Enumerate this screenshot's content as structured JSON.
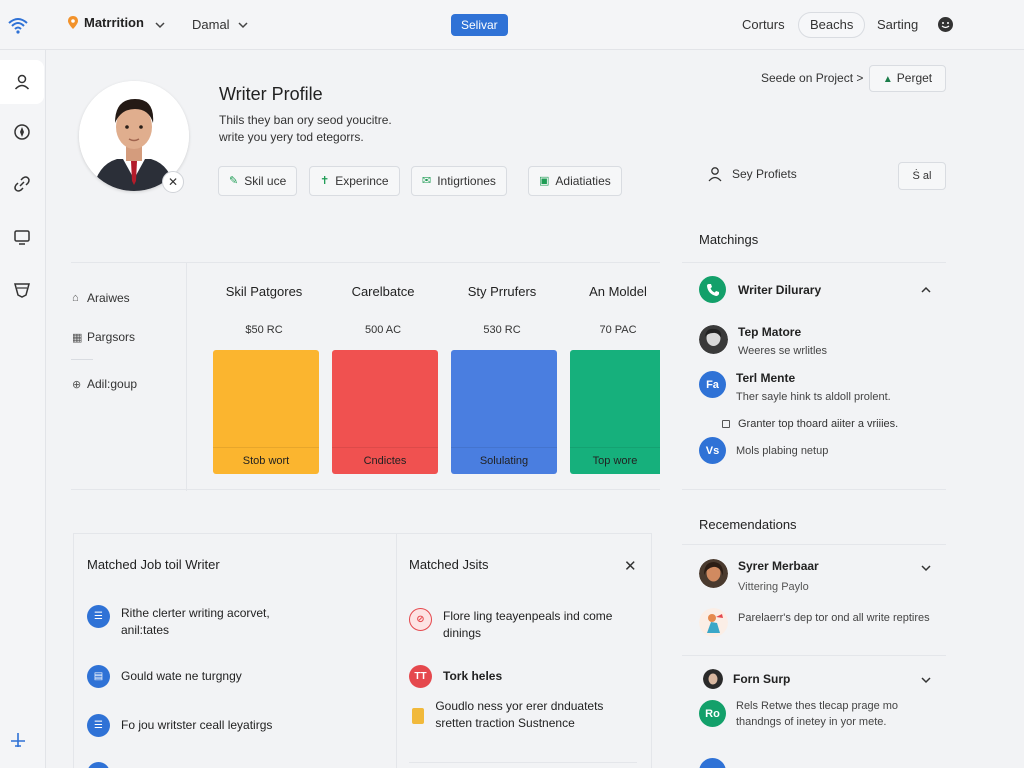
{
  "topbar": {
    "location": "Matrrition",
    "second": "Damal",
    "save_button": "Selivar",
    "link_one": "Corturs",
    "pill": "Beachs",
    "link_two": "Sarting"
  },
  "rail": {
    "items": [
      "profile-icon",
      "compass-icon",
      "link-icon",
      "display-icon",
      "shield-icon",
      "plane-icon"
    ]
  },
  "profile": {
    "title": "Writer Profile",
    "desc_line1": "Thils they ban ory seod youcitre.",
    "desc_line2": "write you yery tod etegorrs.",
    "chips": [
      "Skil uce",
      "Experince",
      "Intigrtiones",
      "Adiatiaties"
    ],
    "seeds_link": "Seede on Project >",
    "perget_button": "Perget",
    "sey_profiles": "Sey Profiets",
    "small_button": "Ṡ al"
  },
  "skills": {
    "side_items": [
      "Araiwes",
      "Pargsors",
      "Adil:goup"
    ],
    "columns": [
      {
        "header": "Skil Patgores",
        "value": "$50 RC",
        "label": "Stob wort",
        "color": "#fbb52f"
      },
      {
        "header": "Carelbatce",
        "value": "500 AC",
        "label": "Cndictes",
        "color": "#f05150"
      },
      {
        "header": "Sty Prrufers",
        "value": "530 RC",
        "label": "Solulating",
        "color": "#4a7ee0"
      },
      {
        "header": "An Moldel",
        "value": "70 PAC",
        "label": "Top wore",
        "color": "#16b07c"
      }
    ]
  },
  "matchings": {
    "title": "Matchings",
    "header": "Writer Dilurary",
    "people": [
      {
        "name": "Tep Matore",
        "desc": "Weeres se wrlitles"
      },
      {
        "name": "Terl Mente",
        "desc": "Ther sayle hink ts aldoll prolent."
      }
    ],
    "check_line": "Granter top thoard aiiter a vriiies.",
    "vs_badge": "Vs",
    "vs_text": "Mols plabing netup",
    "fa_badge": "Fa"
  },
  "recommendations": {
    "title": "Recemendations",
    "items": [
      {
        "name": "Syrer Merbaar",
        "desc": "Vittering Paylo"
      },
      {
        "name": "",
        "desc": "Parelaerr's dep tor ond all write reptires"
      },
      {
        "name": "Forn Surp",
        "desc": ""
      },
      {
        "name": "",
        "desc": "Rels Retwe thes tlecap prage mo thandngs of inetey in yor mete."
      }
    ],
    "ro_badge": "Ro"
  },
  "matched_writer": {
    "title": "Matched Job toil Writer",
    "items": [
      {
        "text": "Rithe clerter writing acorvet, anil:tates"
      },
      {
        "text": "Gould wate ne turgngy"
      },
      {
        "text": "Fo jou writster ceall leyatirgs"
      }
    ]
  },
  "matched_jobs": {
    "title": "Matched Jsits",
    "items": [
      {
        "text": "Flore ling teayenpeals ind come dinings",
        "bold": false
      },
      {
        "text": "Tork heles",
        "bold": true
      },
      {
        "text": "Goudlo ness yor erer dnduatets sretten traction Sustnence",
        "bold": false
      }
    ],
    "tt_badge": "TT"
  },
  "colors": {
    "accent_blue": "#2f72d6",
    "accent_green": "#13a06a",
    "accent_red": "#e5484d"
  }
}
